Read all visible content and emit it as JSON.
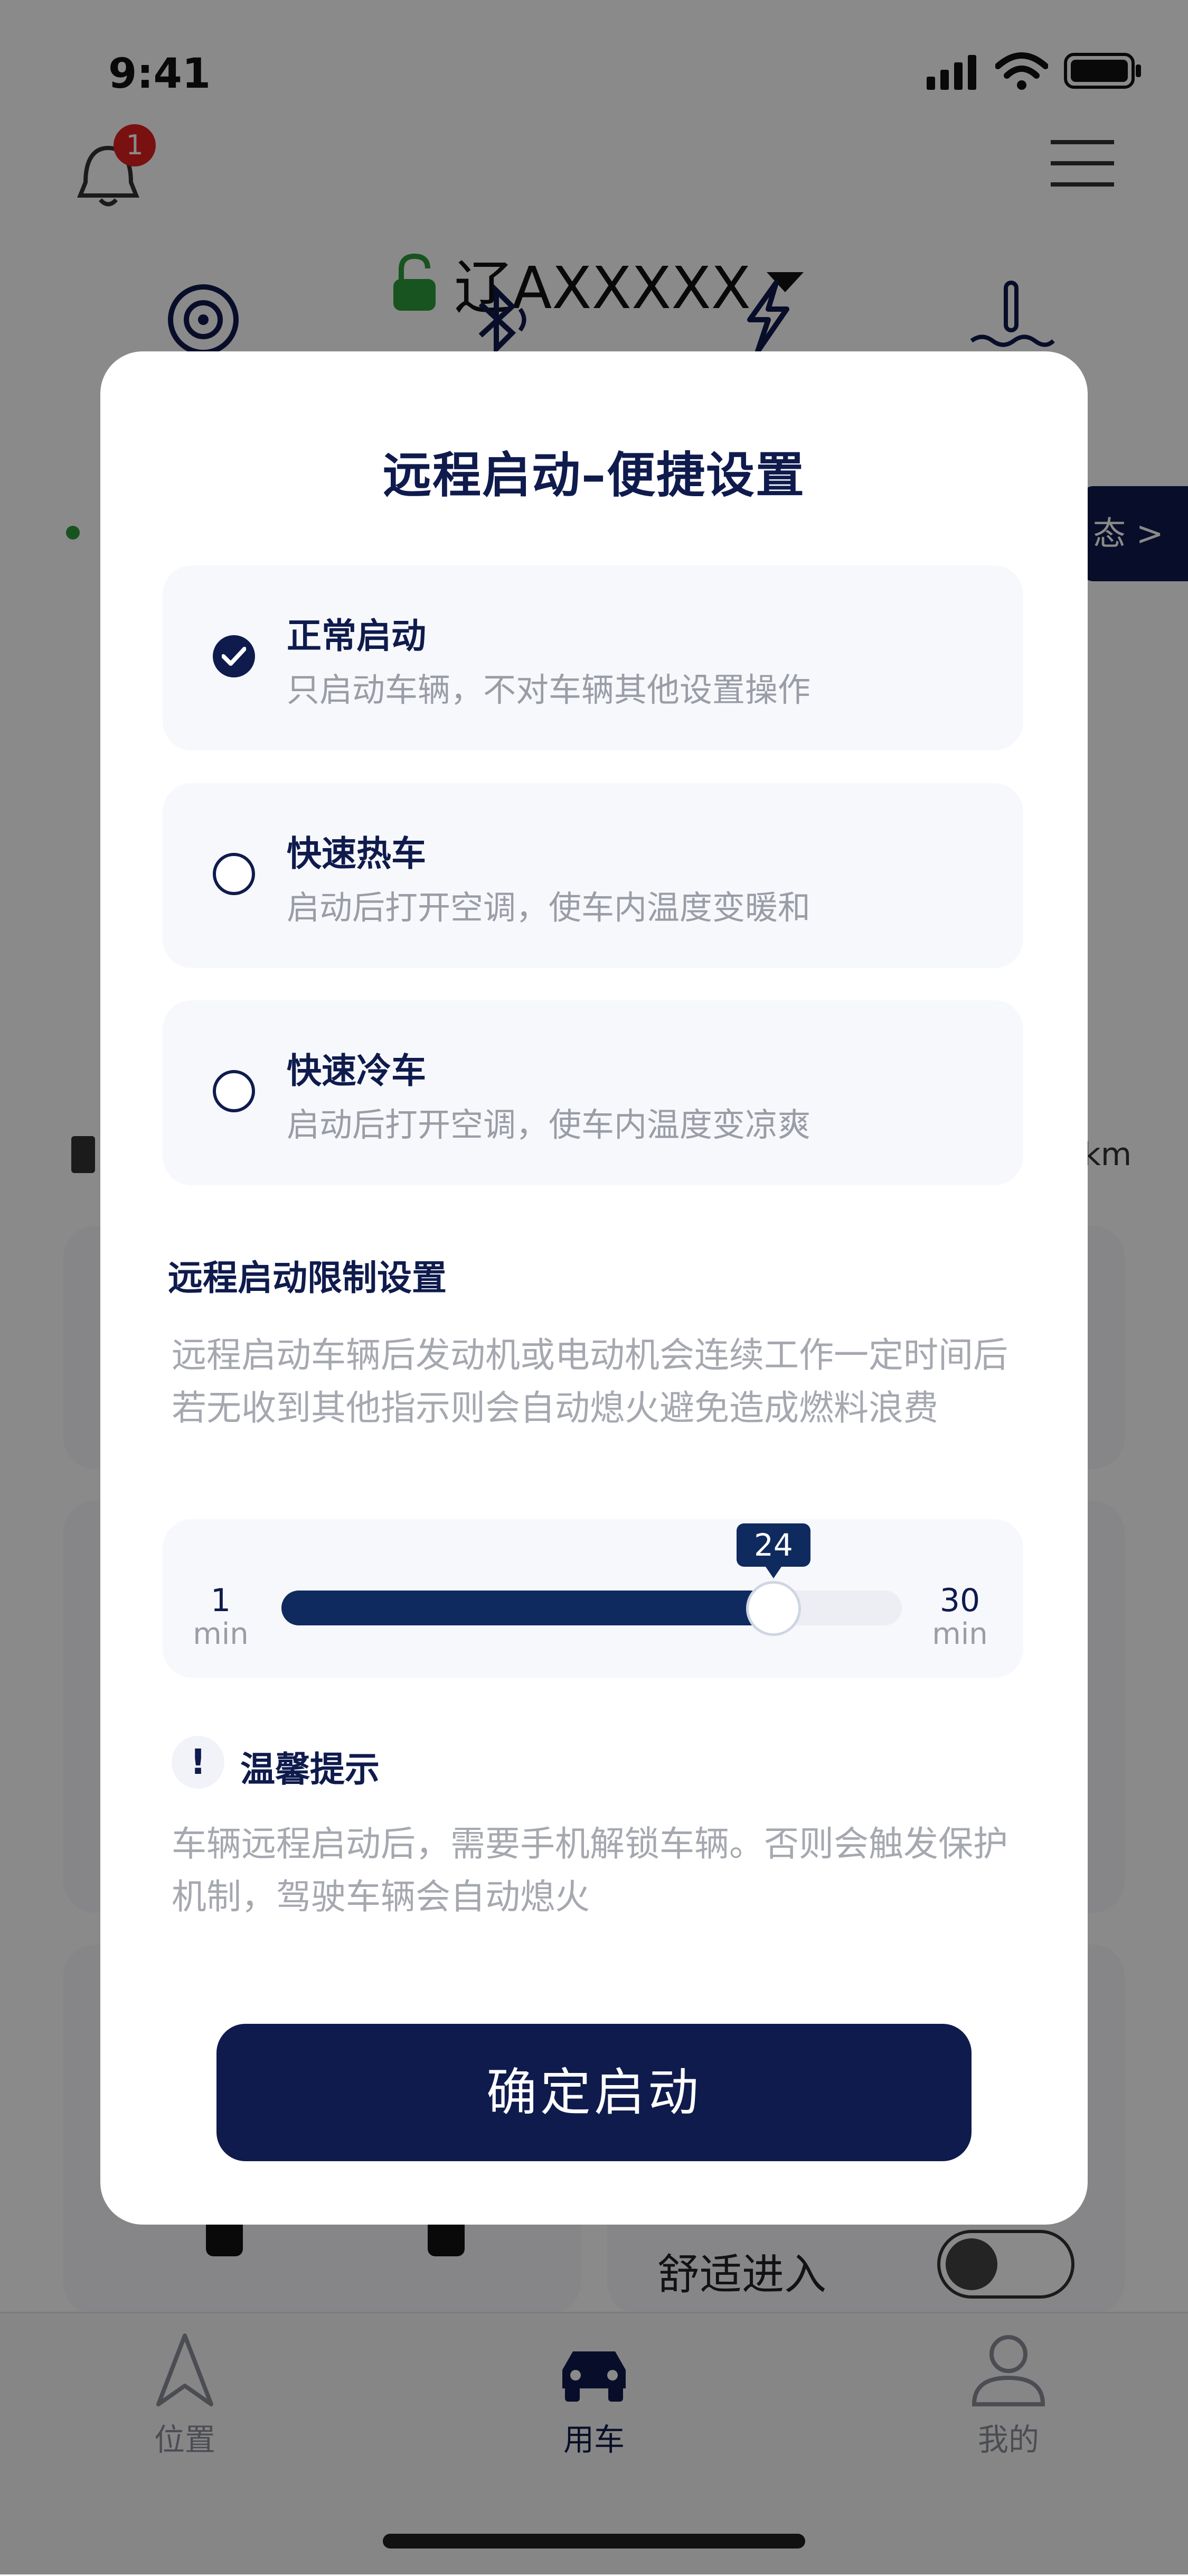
{
  "status_bar": {
    "time": "9:41"
  },
  "header": {
    "notification_count": "1",
    "plate": "辽AXXXXX"
  },
  "background": {
    "right_badge_text": "态 >",
    "range_unit": "km",
    "comfort_entry_label": "舒适进入"
  },
  "tabs": [
    {
      "label": "位置",
      "icon": "location-arrow-icon"
    },
    {
      "label": "用车",
      "icon": "car-icon"
    },
    {
      "label": "我的",
      "icon": "person-icon"
    }
  ],
  "modal": {
    "title": "远程启动–便捷设置",
    "options": [
      {
        "title": "正常启动",
        "desc": "只启动车辆，不对车辆其他设置操作",
        "selected": true
      },
      {
        "title": "快速热车",
        "desc": "启动后打开空调，使车内温度变暖和",
        "selected": false
      },
      {
        "title": "快速冷车",
        "desc": "启动后打开空调，使车内温度变凉爽",
        "selected": false
      }
    ],
    "limit_title": "远程启动限制设置",
    "limit_desc": "远程启动车辆后发动机或电动机会连续工作一定时间后若无收到其他指示则会自动熄火避免造成燃料浪费",
    "slider": {
      "min_value": "1",
      "max_value": "30",
      "unit": "min",
      "current": 24,
      "current_label": "24",
      "min": 1,
      "max": 30
    },
    "tip_icon_text": "!",
    "tip_title": "温馨提示",
    "tip_desc": "车辆远程启动后，需要手机解锁车辆。否则会触发保护机制，驾驶车辆会自动熄火",
    "confirm_label": "确定启动"
  },
  "colors": {
    "primary": "#0f1b4d",
    "slider_fill": "#0f2a5e",
    "badge_red": "#e02020",
    "lock_green": "#2e9b3a",
    "muted_text": "#9a9ca6"
  }
}
